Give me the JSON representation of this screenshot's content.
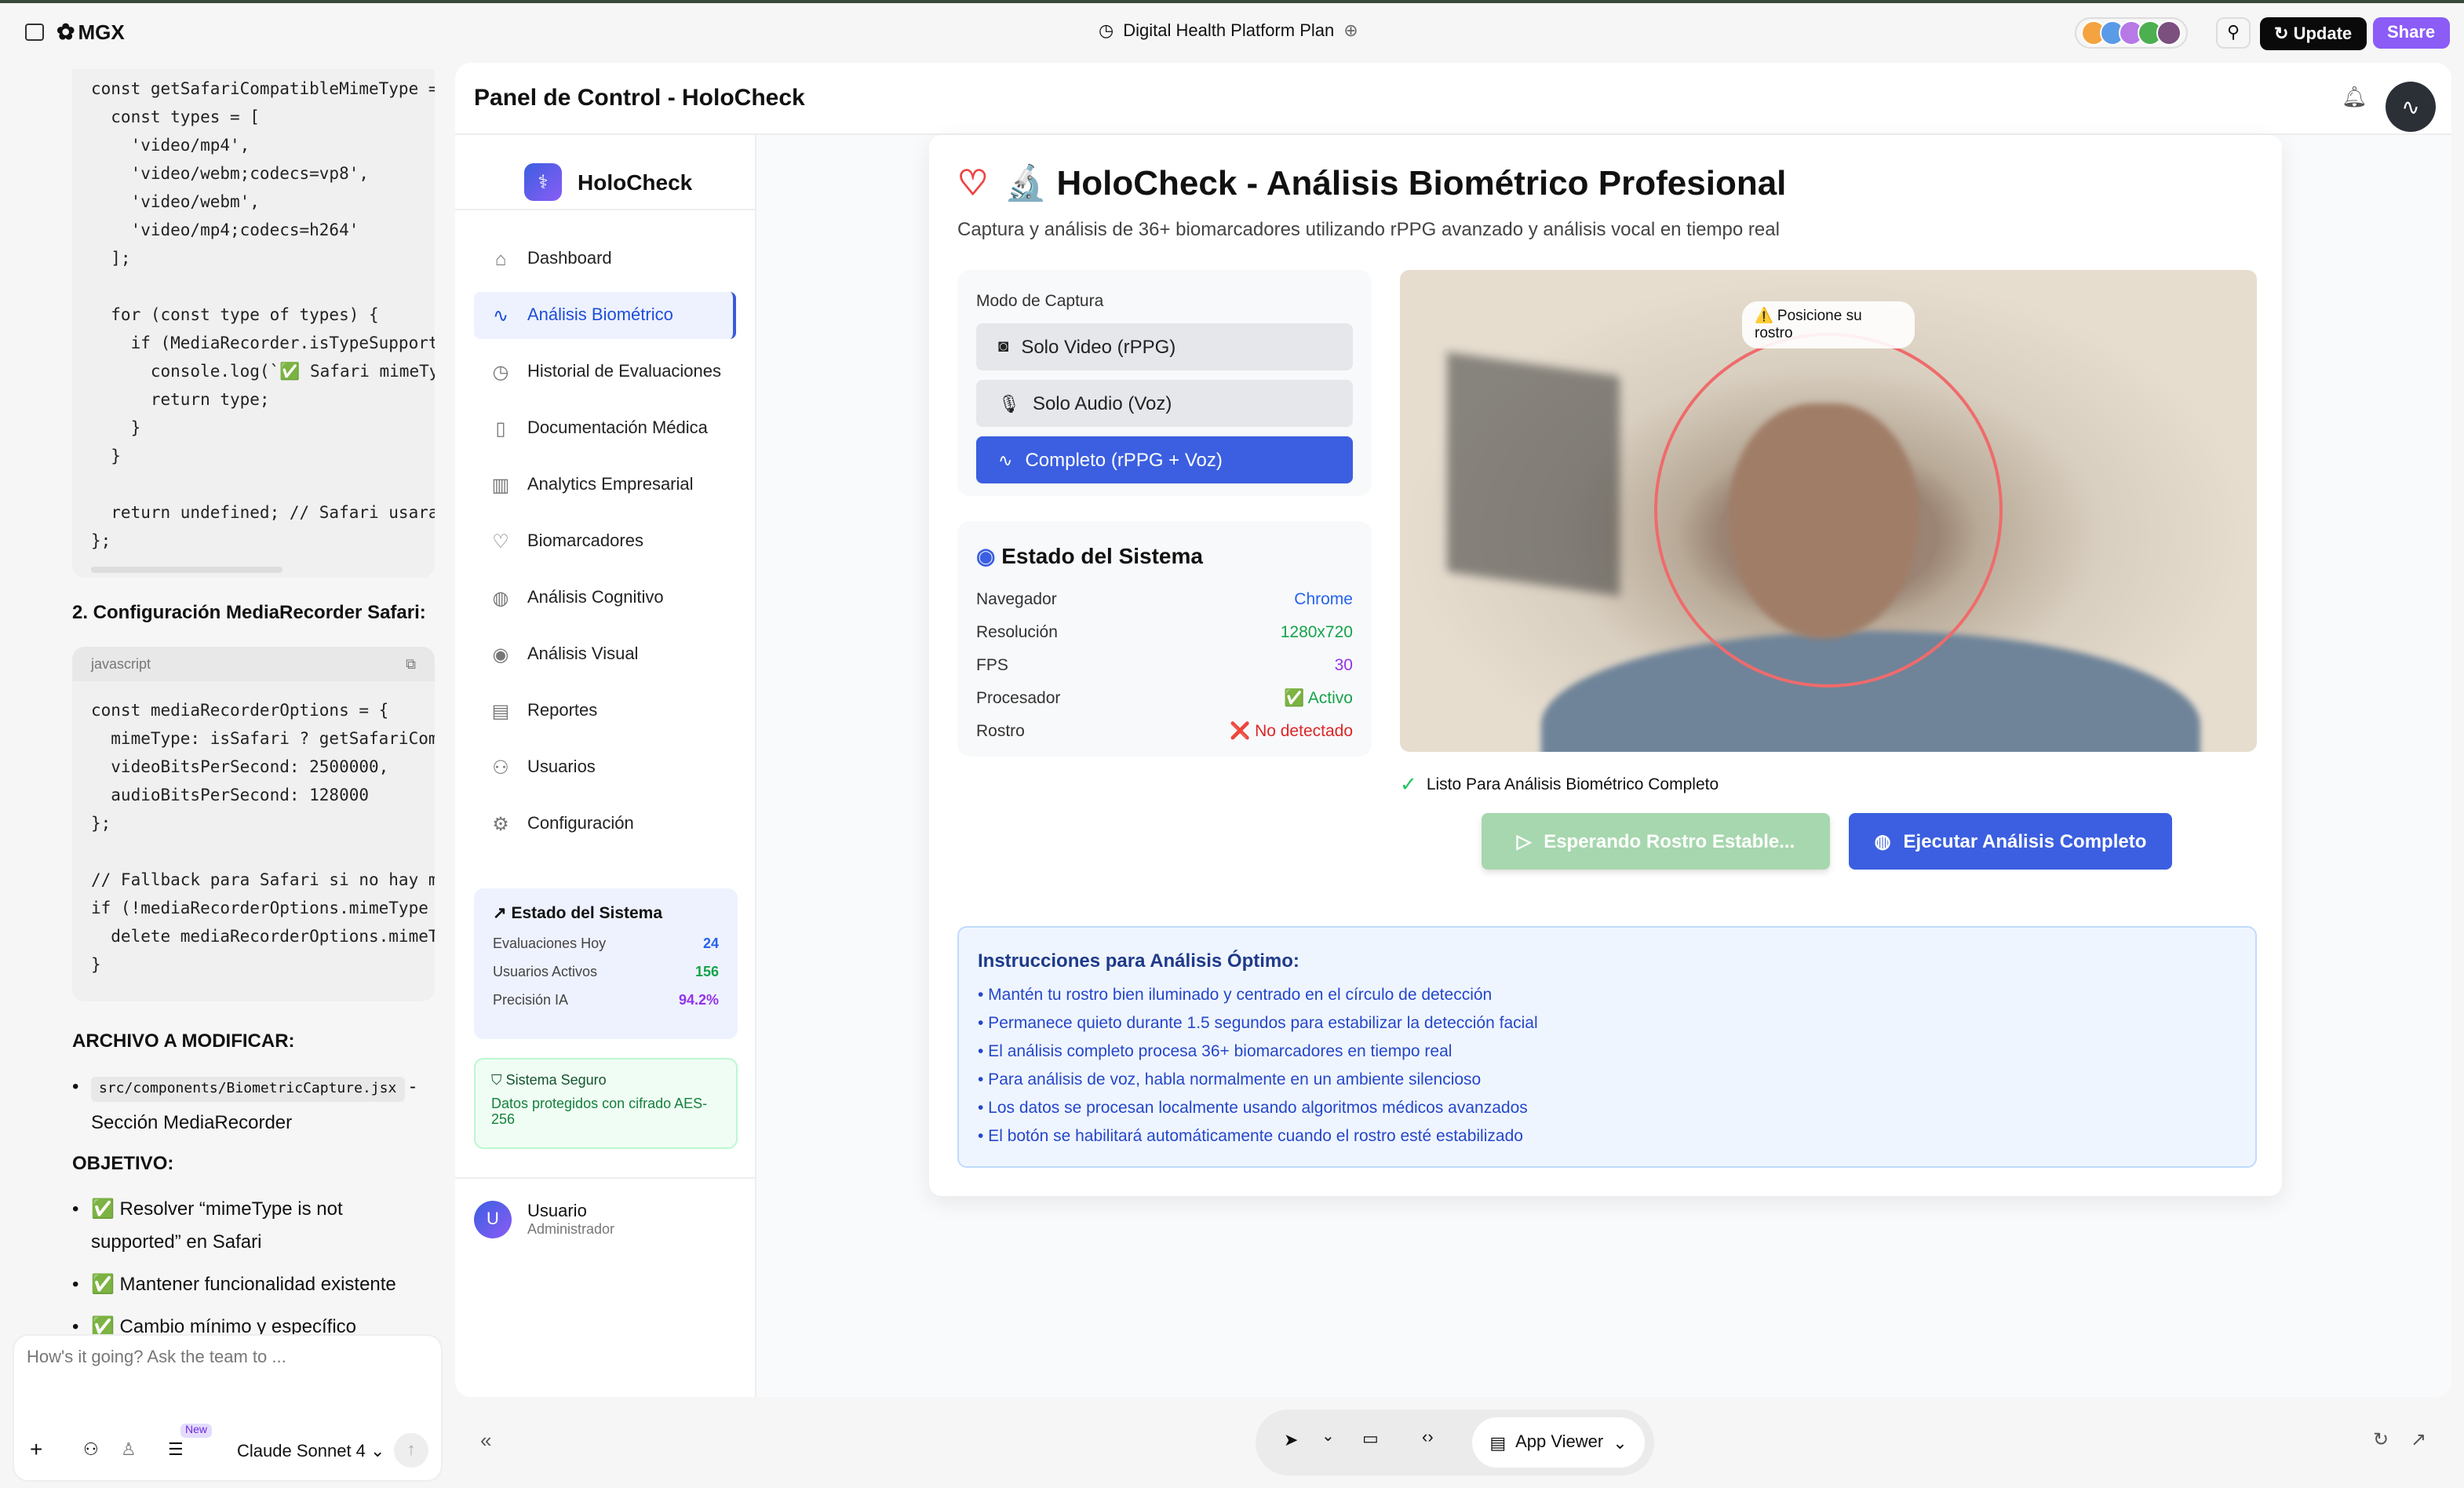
{
  "topbar": {
    "brand": "MGX",
    "project_title": "Digital Health Platform Plan",
    "update_label": "Update",
    "share_label": "Share",
    "avatar_colors": [
      "#f4a340",
      "#5a9be8",
      "#b779e6",
      "#4caf50",
      "#7b4f7e"
    ]
  },
  "chat": {
    "code1": "const getSafariCompatibleMimeType = \n  const types = [\n    'video/mp4',\n    'video/webm;codecs=vp8',\n    'video/webm',\n    'video/mp4;codecs=h264'\n  ];\n\n  for (const type of types) {\n    if (MediaRecorder.isTypeSupport\n      console.log(`✅ Safari mimeTy\n      return type;\n    }\n  }\n\n  return undefined; // Safari usara\n};",
    "heading2": "2. Configuración MediaRecorder Safari:",
    "code2_lang": "javascript",
    "code2": "const mediaRecorderOptions = {\n  mimeType: isSafari ? getSafariCom\n  videoBitsPerSecond: 2500000,\n  audioBitsPerSecond: 128000\n};\n\n// Fallback para Safari si no hay m\nif (!mediaRecorderOptions.mimeType \n  delete mediaRecorderOptions.mimeT\n}",
    "file_heading": "ARCHIVO A MODIFICAR:",
    "file_path": "src/components/BiometricCapture.jsx",
    "file_suffix": " - Sección MediaRecorder",
    "objective_heading": "OBJETIVO:",
    "objectives": [
      "✅ Resolver “mimeType is not supported” en Safari",
      "✅ Mantener funcionalidad existente",
      "✅ Cambio mínimo y específico"
    ],
    "input_placeholder": "How's it going? Ask the team to ...",
    "new_badge": "New",
    "model": "Claude Sonnet 4"
  },
  "app": {
    "header_title": "Panel de Control - HoloCheck",
    "brand": "HoloCheck",
    "nav": [
      {
        "label": "Dashboard",
        "icon": "home-icon"
      },
      {
        "label": "Análisis Biométrico",
        "icon": "activity-icon",
        "active": true
      },
      {
        "label": "Historial de Evaluaciones",
        "icon": "clock-icon"
      },
      {
        "label": "Documentación Médica",
        "icon": "book-icon"
      },
      {
        "label": "Analytics Empresarial",
        "icon": "bar-chart-icon"
      },
      {
        "label": "Biomarcadores",
        "icon": "heart-icon"
      },
      {
        "label": "Análisis Cognitivo",
        "icon": "brain-icon"
      },
      {
        "label": "Análisis Visual",
        "icon": "eye-icon"
      },
      {
        "label": "Reportes",
        "icon": "file-icon"
      },
      {
        "label": "Usuarios",
        "icon": "users-icon"
      },
      {
        "label": "Configuración",
        "icon": "gear-icon"
      }
    ],
    "side_status": {
      "title": "Estado del Sistema",
      "rows": [
        {
          "label": "Evaluaciones Hoy",
          "value": "24",
          "color": "#2563eb"
        },
        {
          "label": "Usuarios Activos",
          "value": "156",
          "color": "#16a34a"
        },
        {
          "label": "Precisión IA",
          "value": "94.2%",
          "color": "#9333ea"
        }
      ]
    },
    "secure": {
      "title": "Sistema Seguro",
      "text": "Datos protegidos con cifrado AES-256"
    },
    "user": {
      "initial": "U",
      "name": "Usuario",
      "role": "Administrador"
    },
    "main": {
      "title": "🔬 HoloCheck - Análisis Biométrico Profesional",
      "subtitle": "Captura y análisis de 36+ biomarcadores utilizando rPPG avanzado y análisis vocal en tiempo real",
      "mode_label": "Modo de Captura",
      "modes": [
        {
          "label": "Solo Video (rPPG)",
          "icon": "camera-icon"
        },
        {
          "label": "Solo Audio (Voz)",
          "icon": "mic-icon"
        },
        {
          "label": "Completo (rPPG + Voz)",
          "icon": "activity-icon",
          "selected": true
        }
      ],
      "status_title": "Estado del Sistema",
      "status": [
        {
          "label": "Navegador",
          "value": "Chrome",
          "color": "#2563eb"
        },
        {
          "label": "Resolución",
          "value": "1280x720",
          "color": "#16a34a"
        },
        {
          "label": "FPS",
          "value": "30",
          "color": "#9333ea"
        },
        {
          "label": "Procesador",
          "value": "✅ Activo",
          "color": "#16a34a"
        },
        {
          "label": "Rostro",
          "value": "❌ No detectado",
          "color": "#dc2626"
        }
      ],
      "face_hint": "⚠️ Posicione su rostro",
      "ready_text": "Listo Para Análisis Biométrico Completo",
      "wait_button": "Esperando Rostro Estable...",
      "run_button": "Ejecutar Análisis Completo",
      "instructions_title": "Instrucciones para Análisis Óptimo:",
      "instructions": [
        "• Mantén tu rostro bien iluminado y centrado en el círculo de detección",
        "• Permanece quieto durante 1.5 segundos para estabilizar la detección facial",
        "• El análisis completo procesa 36+ biomarcadores en tiempo real",
        "• Para análisis de voz, habla normalmente en un ambiente silencioso",
        "• Los datos se procesan localmente usando algoritmos médicos avanzados",
        "• El botón se habilitará automáticamente cuando el rostro esté estabilizado"
      ]
    }
  },
  "bottombar": {
    "viewer_label": "App Viewer"
  }
}
